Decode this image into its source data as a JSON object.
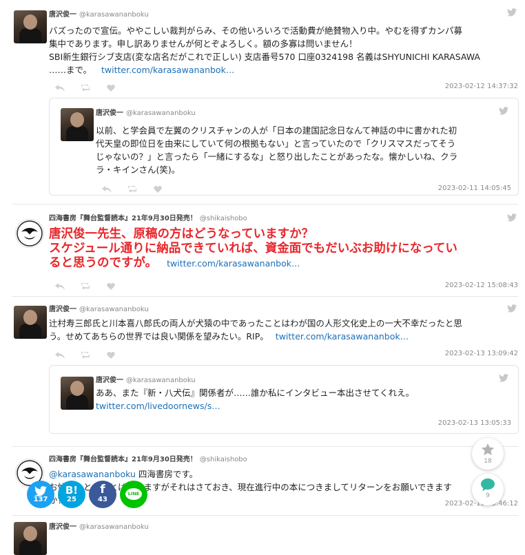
{
  "tweets": [
    {
      "name": "唐沢俊一",
      "handle": "@karasawananboku",
      "lines": [
        "バズったので宣伝。ややこしい裁判がらみ、その他いろいろで活動費が絶賛物入り中。やむを得ずカンパ募",
        "集中であります。申し訳ありませんが何とぞよろしく。額の多寡は問いません！",
        "SBI新生銀行シブ支店(変な店名だがこれで正しい) 支店番号570 口座0324198 名義はSHYUNICHI KARASAWA",
        "……まで。"
      ],
      "link": "twitter.com/karasawananbok…",
      "timestamp": "2023-02-12 14:37:32",
      "quote": {
        "name": "唐沢俊一",
        "handle": "@karasawananboku",
        "lines": [
          "以前、と学会員で左翼のクリスチャンの人が「日本の建国記念日なんて神話の中に書かれた初",
          "代天皇の即位日を由来にしていて何の根拠もない」と言っていたので「クリスマスだってそう",
          "じゃないの？」と言ったら「一緒にするな」と怒り出したことがあったな。懐かしいね、クラ",
          "ラ・キインさん(笑)。"
        ],
        "timestamp": "2023-02-11 14:05:45"
      }
    },
    {
      "name": "四海書房『舞台監督読本』21年9月30日発売！",
      "handle": "@shikaishobo",
      "lines": [
        "唐沢俊一先生、原稿の方はどうなっていますか？",
        "スケジュール通りに納品できていれば、資金面でもだいぶお助けになってい",
        "ると思うのですが。"
      ],
      "link": "twitter.com/karasawananbok…",
      "timestamp": "2023-02-12 15:08:43"
    },
    {
      "name": "唐沢俊一",
      "handle": "@karasawananboku",
      "lines": [
        "辻村寿三郎氏と川本喜八郎氏の両人が犬猿の中であったことはわが国の人形文化史上の一大不幸だったと思",
        "う。せめてあちらの世界では良い関係を望みたい。RIP。"
      ],
      "link": "twitter.com/karasawananbok…",
      "timestamp": "2023-02-13 13:09:42",
      "quote": {
        "name": "唐沢俊一",
        "handle": "@karasawananboku",
        "lines": [
          "ああ、また『新・八犬伝』関係者が……誰か私にインタビュー本出させてくれえ。"
        ],
        "link": "twitter.com/livedoornews/s…",
        "timestamp": "2023-02-13 13:05:33"
      }
    },
    {
      "name": "四海書房『舞台監督読本』21年9月30日発売！",
      "handle": "@shikaishobo",
      "mention": "@karasawananboku",
      "line1_rest": " 四海書房です。",
      "line2": "お忙しいところとは思いますがそれはさておき、現在進行中の本につきましてリターンをお願いできますか？",
      "timestamp": "2023-02-13 13:46:12"
    },
    {
      "name": "唐沢俊一",
      "handle": "@karasawananboku"
    }
  ],
  "share": {
    "twitter": {
      "count": "137",
      "color": "#1da1f2"
    },
    "hatena": {
      "label": "B!",
      "count": "25",
      "color": "#00a4de"
    },
    "facebook": {
      "label": "f",
      "count": "43",
      "color": "#3b5998"
    },
    "line": {
      "label": "LINE",
      "color": "#00c300"
    }
  },
  "fab": {
    "star": {
      "count": "18"
    },
    "comment": {
      "count": "9"
    }
  }
}
